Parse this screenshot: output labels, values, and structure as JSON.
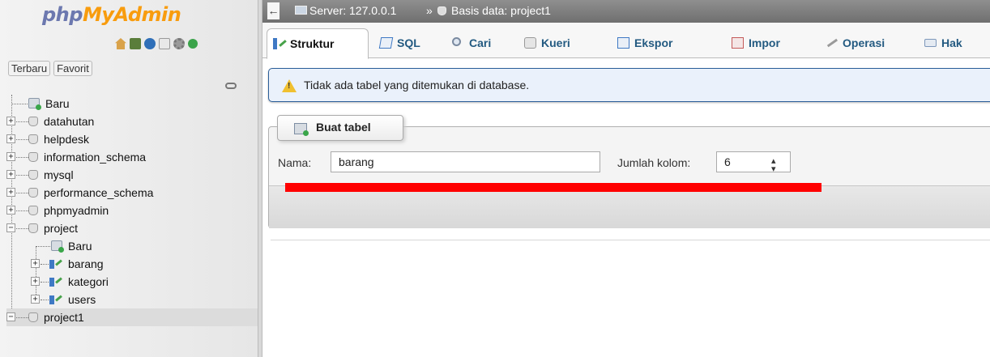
{
  "nav": {
    "logo_php": "php",
    "logo_myadmin": "MyAdmin",
    "quick_icons": [
      "home-icon",
      "exit-icon",
      "help-icon",
      "docs-icon",
      "settings-icon",
      "reload-icon"
    ],
    "tabs": [
      "Terbaru",
      "Favorit"
    ],
    "tree": [
      {
        "label": "Baru"
      },
      {
        "label": "datahutan"
      },
      {
        "label": "helpdesk"
      },
      {
        "label": "information_schema"
      },
      {
        "label": "mysql"
      },
      {
        "label": "performance_schema"
      },
      {
        "label": "phpmyadmin"
      },
      {
        "label": "project"
      },
      {
        "label": "Baru"
      },
      {
        "label": "barang"
      },
      {
        "label": "kategori"
      },
      {
        "label": "users"
      },
      {
        "label": "project1"
      }
    ]
  },
  "breadcrumb": {
    "server": "Server: 127.0.0.1",
    "separator": "»",
    "database": "Basis data: project1"
  },
  "tabs": [
    "Struktur",
    "SQL",
    "Cari",
    "Kueri",
    "Ekspor",
    "Impor",
    "Operasi",
    "Hak"
  ],
  "notice": {
    "text": "Tidak ada tabel yang ditemukan di database."
  },
  "create_table": {
    "legend": "Buat tabel",
    "name_label": "Nama:",
    "name_value": "barang",
    "columns_label": "Jumlah kolom:",
    "columns_value": "6"
  },
  "colors": {
    "accent_link": "#235a81",
    "annotation": "#ff0000",
    "notice_border": "#2b5e99"
  }
}
